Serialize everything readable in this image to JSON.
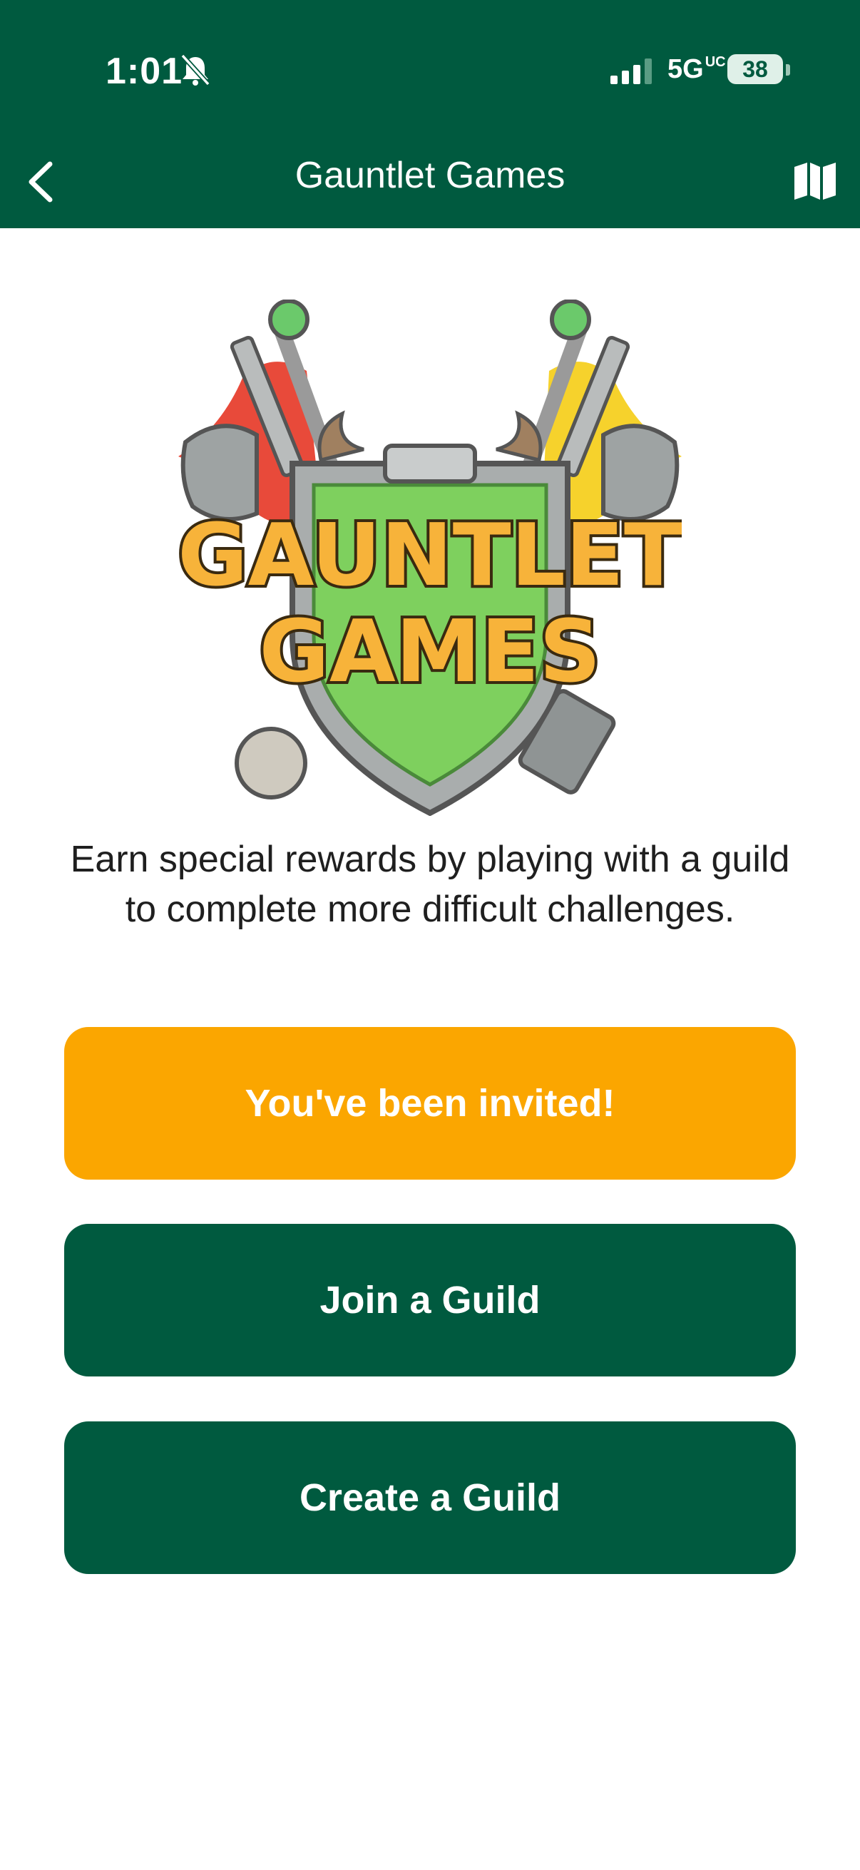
{
  "status_bar": {
    "time": "1:01",
    "network": "5G",
    "network_suffix": "UC",
    "battery": "38"
  },
  "nav": {
    "title": "Gauntlet Games"
  },
  "logo": {
    "line1": "GAUNTLET",
    "line2": "GAMES"
  },
  "description": "Earn special rewards by playing with a guild to complete more difficult challenges.",
  "buttons": {
    "invited": "You've been invited!",
    "join": "Join a Guild",
    "create": "Create a Guild"
  },
  "colors": {
    "brand_green": "#005a3f",
    "accent_orange": "#fba600"
  }
}
